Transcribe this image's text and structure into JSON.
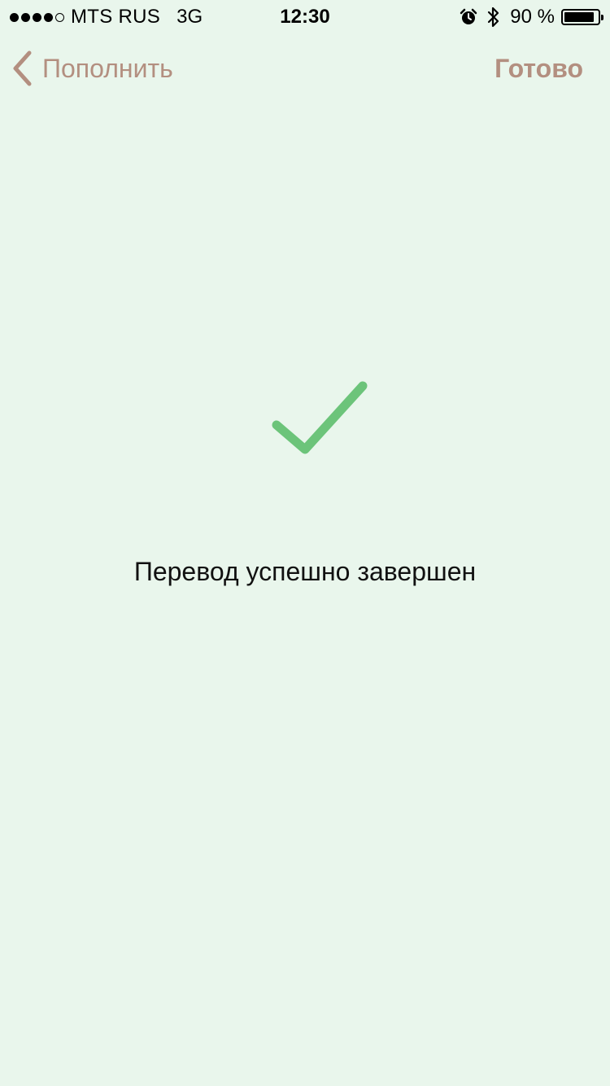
{
  "status_bar": {
    "signal_filled": 4,
    "signal_total": 5,
    "carrier": "MTS RUS",
    "network": "3G",
    "time": "12:30",
    "battery_percent": "90 %",
    "battery_level": 0.9,
    "icons": [
      "alarm-icon",
      "bluetooth-icon",
      "battery-icon"
    ]
  },
  "nav": {
    "back_label": "Пополнить",
    "done_label": "Готово",
    "accent_color": "#b38f80"
  },
  "main": {
    "message": "Перевод успешно завершен",
    "check_color": "#6cc47a",
    "icon": "checkmark-icon"
  }
}
